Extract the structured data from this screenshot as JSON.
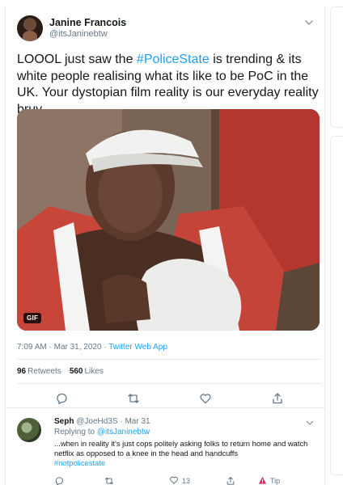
{
  "tweet": {
    "display_name": "Janine Francois",
    "handle": "@itsJaninebtw",
    "text_before": "LOOOL just saw the ",
    "hashtag": "#PoliceState",
    "text_after": " is trending & its white people  realising what its like to be PoC in the UK. Your dystopian film reality is our everyday reality bruv.",
    "media_badge": "GIF",
    "time": "7:09 AM",
    "date": "Mar 31, 2020",
    "separator": "·",
    "source": "Twitter Web App",
    "retweets_count": "96",
    "retweets_label": "Retweets",
    "likes_count": "560",
    "likes_label": "Likes",
    "icons": {
      "reply": "reply-icon",
      "retweet": "retweet-icon",
      "like": "heart-icon",
      "share": "share-icon",
      "more": "chevron-down-icon"
    }
  },
  "reply": {
    "display_name": "Seph",
    "handle": "@JoeHd3S",
    "separator": "·",
    "date": "Mar 31",
    "replying_label": "Replying to",
    "replying_to": "@itsJaninebtw",
    "text": "...when in reality it's just cops politely asking folks to return home and watch netflix as opposed to a knee in the head and handcuffs",
    "hashtag": "#notpolicestate",
    "like_count": "13",
    "tip_label": "Tip"
  },
  "colors": {
    "accent": "#1da1f2",
    "secondary_text": "#657786",
    "primary_text": "#14171a",
    "tip_icon": "#e0245e"
  }
}
